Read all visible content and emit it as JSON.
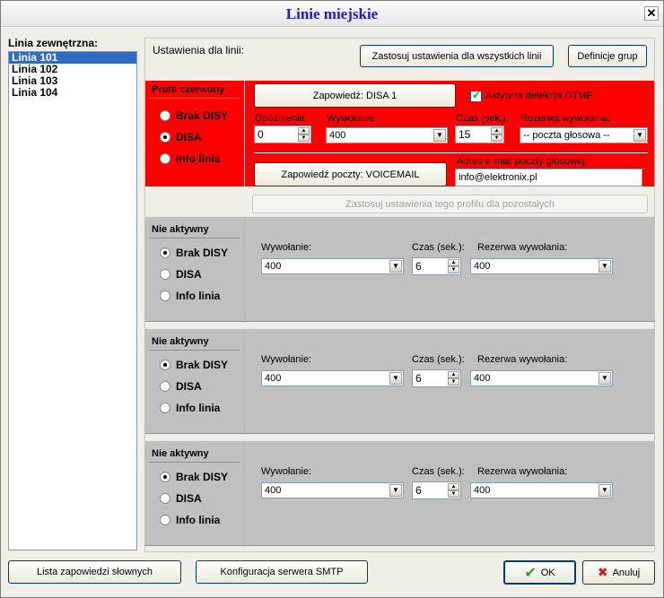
{
  "window": {
    "title": "Linie miejskie",
    "close_glyph": "✕"
  },
  "lines_list": {
    "label": "Linia zewnętrzna:",
    "items": [
      "Linia 101",
      "Linia 102",
      "Linia 103",
      "Linia 104"
    ],
    "selected": "Linia 101"
  },
  "settings": {
    "label": "Ustawienia dla linii:",
    "apply_all_label": "Zastosuj ustawienia dla wszystkich linii",
    "group_defs_label": "Definicje grup"
  },
  "red_profile": {
    "title": "Profil czerwony",
    "color": "#ff0000",
    "options": [
      "Brak DISY",
      "DISA",
      "Info linia"
    ],
    "selected": "DISA",
    "announce_button": "Zapowiedź: DISA 1",
    "dtmf_label": "Aktywna detekcja DTMF",
    "dtmf_checked": true,
    "delay_label": "Opóźnienie:",
    "delay_value": "0",
    "call_label": "Wywołanie:",
    "call_value": "400",
    "time_label": "Czas (sek.):",
    "time_value": "15",
    "reserve_label": "Rezerwa wywołania:",
    "reserve_value": "-- poczta głosowa --",
    "voicemail_button": "Zapowiedź poczty: VOICEMAIL",
    "email_label": "Adres e-mail poczty głosowej:",
    "email_value": "info@elektronix.pl",
    "apply_profile_label": "Zastosuj ustawienia tego profilu dla pozostałych"
  },
  "inactive_profiles": [
    {
      "title": "Nie aktywny",
      "options": [
        "Brak DISY",
        "DISA",
        "Info linia"
      ],
      "selected": "Brak DISY",
      "call_label": "Wywołanie:",
      "call_value": "400",
      "time_label": "Czas (sek.):",
      "time_value": "6",
      "reserve_label": "Rezerwa wywołania:",
      "reserve_value": "400"
    },
    {
      "title": "Nie aktywny",
      "options": [
        "Brak DISY",
        "DISA",
        "Info linia"
      ],
      "selected": "Brak DISY",
      "call_label": "Wywołanie:",
      "call_value": "400",
      "time_label": "Czas (sek.):",
      "time_value": "6",
      "reserve_label": "Rezerwa wywołania:",
      "reserve_value": "400"
    },
    {
      "title": "Nie aktywny",
      "options": [
        "Brak DISY",
        "DISA",
        "Info linia"
      ],
      "selected": "Brak DISY",
      "call_label": "Wywołanie:",
      "call_value": "400",
      "time_label": "Czas (sek.):",
      "time_value": "6",
      "reserve_label": "Rezerwa wywołania:",
      "reserve_value": "400"
    }
  ],
  "footer": {
    "announcements_list": "Lista zapowiedzi słownych",
    "smtp_config": "Konfiguracja serwera SMTP",
    "ok_label": "OK",
    "ok_icon": "✔",
    "cancel_label": "Anuluj",
    "cancel_icon": "✖"
  },
  "icons": {
    "dropdown": "▼",
    "spin_up": "▲",
    "spin_down": "▼"
  }
}
